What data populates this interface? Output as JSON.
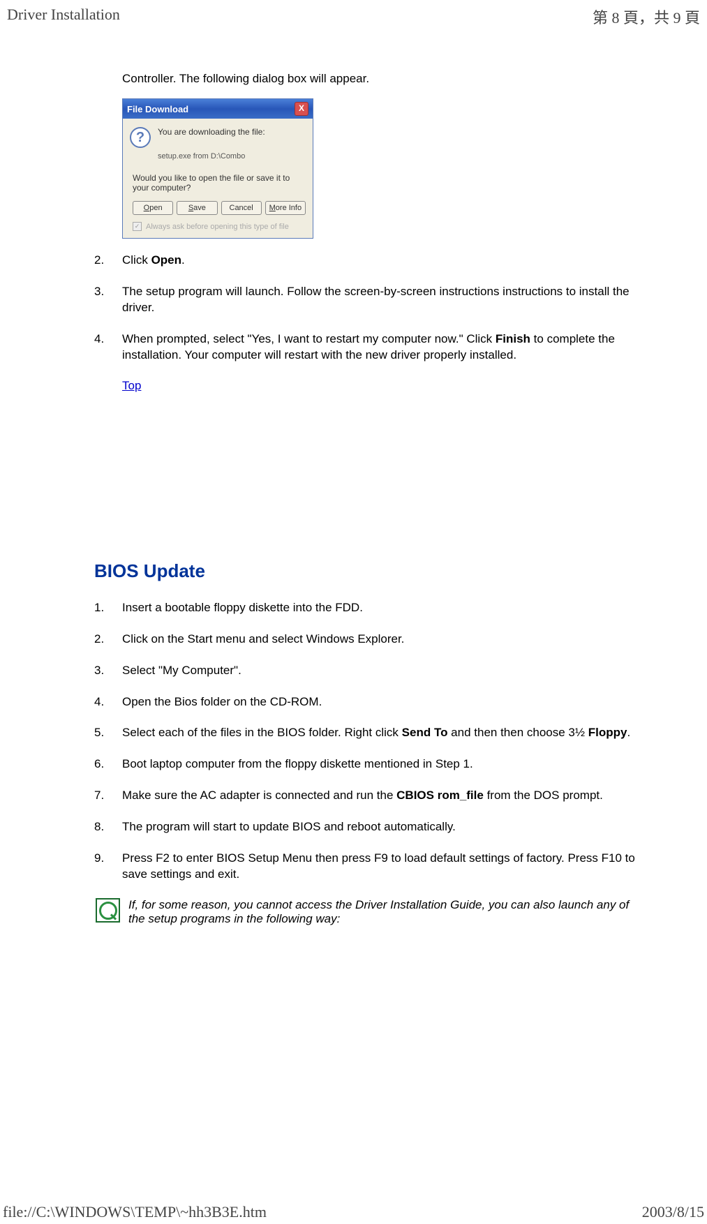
{
  "header": {
    "left": "Driver Installation",
    "right": "第 8 頁，共 9 頁"
  },
  "intro": "Controller. The following dialog box will appear.",
  "dialog": {
    "title": "File Download",
    "close_char": "X",
    "q_char": "?",
    "line1": "You are downloading the file:",
    "line2": "setup.exe from D:\\Combo",
    "question": "Would you like to open the file or save it to your computer?",
    "btn_open_u": "O",
    "btn_open_rest": "pen",
    "btn_save_u": "S",
    "btn_save_rest": "ave",
    "btn_cancel": "Cancel",
    "btn_more_u": "M",
    "btn_more_rest": "ore Info",
    "check_mark": "✓",
    "check_pre": "Al",
    "check_u": "w",
    "check_post": "ays ask before opening this type of file"
  },
  "steps": {
    "s2_num": "2.",
    "s2_pre": "Click ",
    "s2_bold": "Open",
    "s2_post": ".",
    "s3_num": "3.",
    "s3_text": "The setup program will launch. Follow the screen-by-screen instructions instructions to install the driver.",
    "s4_num": "4.",
    "s4_pre": "When prompted, select \"Yes, I want to restart my computer now.\" Click ",
    "s4_bold": "Finish",
    "s4_post": " to complete the installation. Your computer will restart with the new driver properly installed."
  },
  "top_link": "Top",
  "bios_heading": "BIOS Update",
  "bios": {
    "b1_num": "1.",
    "b1_text": "Insert a bootable floppy diskette into the FDD.",
    "b2_num": "2.",
    "b2_text": "Click on the Start menu and select Windows Explorer.",
    "b3_num": "3.",
    "b3_text": "Select \"My Computer\".",
    "b4_num": "4.",
    "b4_text": "Open the Bios folder on the CD-ROM.",
    "b5_num": "5.",
    "b5_pre": "Select each of the files in the BIOS folder. Right click ",
    "b5_bold1": "Send To",
    "b5_mid": " and then then choose 3½ ",
    "b5_bold2": "Floppy",
    "b5_post": ".",
    "b6_num": "6.",
    "b6_text": "Boot laptop computer from the floppy diskette mentioned in Step 1.",
    "b7_num": "7.",
    "b7_pre": "Make sure the AC adapter is connected and run the ",
    "b7_bold": "CBIOS rom_file",
    "b7_post": " from the DOS prompt.",
    "b8_num": "8.",
    "b8_text": "The program will start to update BIOS and reboot automatically.",
    "b9_num": "9.",
    "b9_text": "Press F2 to enter BIOS Setup Menu then press F9 to load default settings of factory. Press F10 to save settings and exit."
  },
  "note": "If, for some reason, you cannot access the Driver Installation Guide, you can also launch any of the setup programs in the following way:",
  "footer": {
    "left": "file://C:\\WINDOWS\\TEMP\\~hh3B3E.htm",
    "right": "2003/8/15"
  }
}
